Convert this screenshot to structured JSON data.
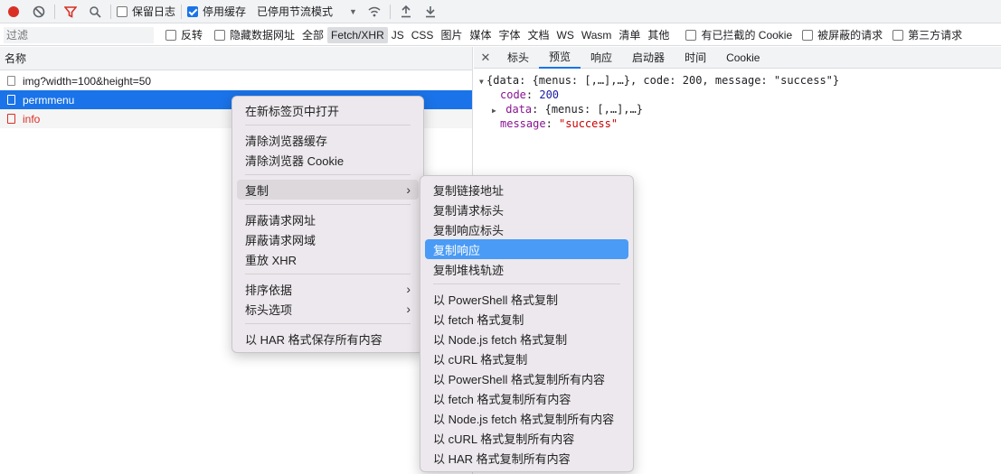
{
  "toolbar": {
    "preserve_log": "保留日志",
    "disable_cache": "停用缓存",
    "throttle": "已停用节流模式"
  },
  "filter": {
    "placeholder": "过滤",
    "invert": "反转",
    "hide_data_urls": "隐藏数据网址",
    "types": [
      "全部",
      "Fetch/XHR",
      "JS",
      "CSS",
      "图片",
      "媒体",
      "字体",
      "文档",
      "WS",
      "Wasm",
      "清单",
      "其他"
    ],
    "blocked_cookies": "有已拦截的 Cookie",
    "blocked_requests": "被屏蔽的请求",
    "third_party": "第三方请求"
  },
  "requests": {
    "column_name": "名称",
    "rows": [
      "img?width=100&height=50",
      "permmenu",
      "info"
    ]
  },
  "detail_tabs": [
    "标头",
    "预览",
    "响应",
    "启动器",
    "时间",
    "Cookie"
  ],
  "preview": {
    "line1": "{data: {menus: [,…],…}, code: 200, message: \"success\"}",
    "code_key": "code",
    "code_val": "200",
    "data_key": "data",
    "data_val": "{menus: [,…],…}",
    "message_key": "message",
    "message_val": "\"success\""
  },
  "context_menu": {
    "items": [
      "在新标签页中打开",
      "清除浏览器缓存",
      "清除浏览器 Cookie",
      "复制",
      "屏蔽请求网址",
      "屏蔽请求网域",
      "重放 XHR",
      "排序依据",
      "标头选项",
      "以 HAR 格式保存所有内容"
    ]
  },
  "copy_submenu": {
    "items": [
      "复制链接地址",
      "复制请求标头",
      "复制响应标头",
      "复制响应",
      "复制堆栈轨迹",
      "以 PowerShell 格式复制",
      "以 fetch 格式复制",
      "以 Node.js fetch 格式复制",
      "以 cURL 格式复制",
      "以 PowerShell 格式复制所有内容",
      "以 fetch 格式复制所有内容",
      "以 Node.js fetch 格式复制所有内容",
      "以 cURL 格式复制所有内容",
      "以 HAR 格式复制所有内容"
    ]
  }
}
